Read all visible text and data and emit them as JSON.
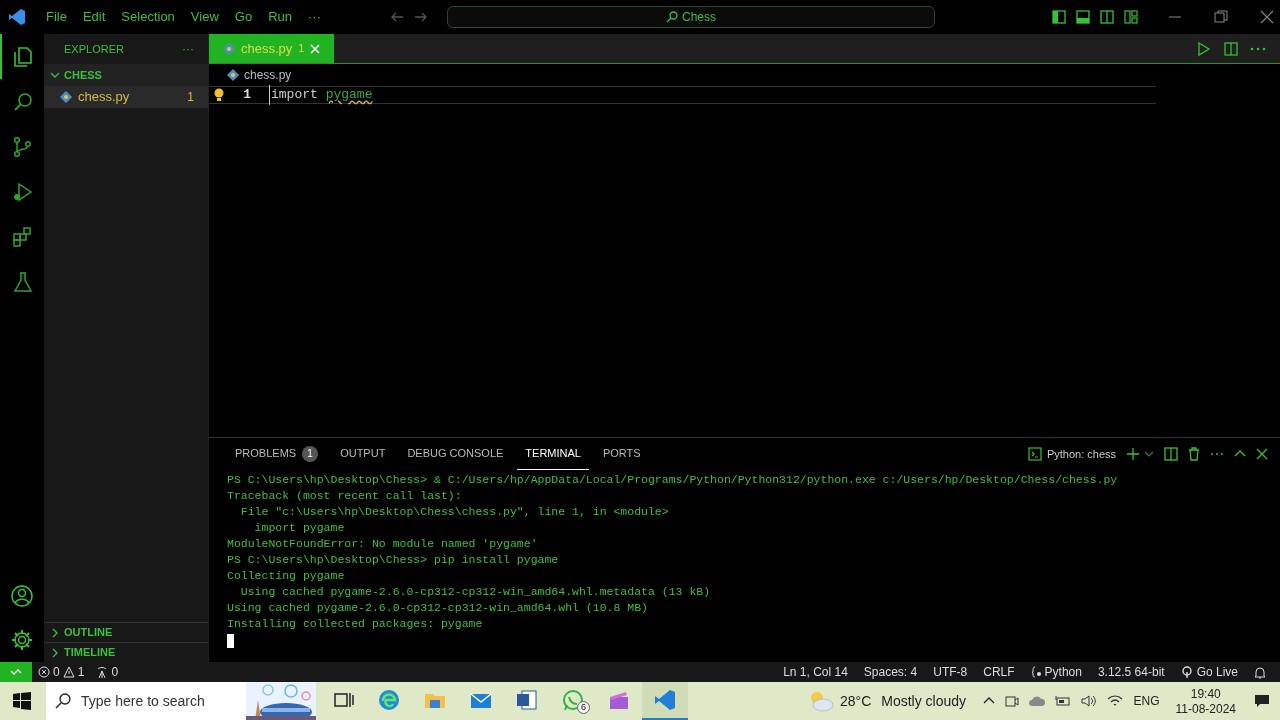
{
  "menu": [
    "File",
    "Edit",
    "Selection",
    "View",
    "Go",
    "Run",
    "···"
  ],
  "command_center": {
    "text": "Chess"
  },
  "activity_bar": [
    {
      "kind": "files",
      "selected": true
    },
    {
      "kind": "search",
      "selected": false
    },
    {
      "kind": "source",
      "selected": false
    },
    {
      "kind": "debug",
      "selected": false
    },
    {
      "kind": "extensions",
      "selected": false
    },
    {
      "kind": "testing",
      "selected": false
    }
  ],
  "sidebar": {
    "title": "EXPLORER",
    "more": "···",
    "folder": {
      "label": "CHESS",
      "expanded": true,
      "files": [
        {
          "name": "chess.py",
          "problems": "1",
          "selected": true
        }
      ]
    },
    "sections": [
      {
        "label": "OUTLINE",
        "expanded": false
      },
      {
        "label": "TIMELINE",
        "expanded": false
      }
    ]
  },
  "editor": {
    "tabs": [
      {
        "label": "chess.py",
        "problems": "1",
        "selected": true
      }
    ],
    "breadcrumb": "chess.py",
    "lines": [
      {
        "number": "1",
        "tokens": [
          {
            "text": "import",
            "kind": "keyword"
          },
          {
            "text": "pygame",
            "kind": "warning"
          }
        ]
      }
    ]
  },
  "panel": {
    "tabs": [
      {
        "label": "PROBLEMS",
        "badge": "1",
        "selected": false
      },
      {
        "label": "OUTPUT",
        "selected": false
      },
      {
        "label": "DEBUG CONSOLE",
        "selected": false
      },
      {
        "label": "TERMINAL",
        "selected": true
      },
      {
        "label": "PORTS",
        "selected": false
      }
    ],
    "terminal_profile": "Python: chess",
    "terminal_lines": [
      "PS C:\\Users\\hp\\Desktop\\Chess> & C:/Users/hp/AppData/Local/Programs/Python/Python312/python.exe c:/Users/hp/Desktop/Chess/chess.py",
      "Traceback (most recent call last):",
      "  File \"c:\\Users\\hp\\Desktop\\Chess\\chess.py\", line 1, in <module>",
      "    import pygame",
      "ModuleNotFoundError: No module named 'pygame'",
      "PS C:\\Users\\hp\\Desktop\\Chess> pip install pygame",
      "Collecting pygame",
      "  Using cached pygame-2.6.0-cp312-cp312-win_amd64.whl.metadata (13 kB)",
      "Using cached pygame-2.6.0-cp312-cp312-win_amd64.whl (10.8 MB)",
      "Installing collected packages: pygame"
    ]
  },
  "status_bar": {
    "errors": "0",
    "warnings": "1",
    "ports": "0",
    "right": [
      {
        "kind": "text",
        "text": "Ln 1, Col 14"
      },
      {
        "kind": "text",
        "text": "Spaces: 4"
      },
      {
        "kind": "text",
        "text": "UTF-8"
      },
      {
        "kind": "text",
        "text": "CRLF"
      },
      {
        "kind": "language",
        "text": "Python"
      },
      {
        "kind": "text",
        "text": "3.12.5 64-bit"
      },
      {
        "kind": "live",
        "text": "Go Live"
      },
      {
        "kind": "bell"
      }
    ]
  },
  "taskbar": {
    "search": {
      "placeholder": "Type here to search"
    },
    "apps": [
      {
        "kind": "taskview"
      },
      {
        "kind": "edge"
      },
      {
        "kind": "folder"
      },
      {
        "kind": "mail"
      },
      {
        "kind": "word"
      },
      {
        "kind": "chat",
        "badge": "6"
      },
      {
        "kind": "clapper"
      },
      {
        "kind": "code",
        "selected": true
      }
    ],
    "weather": {
      "temperature": "28°C",
      "condition": "Mostly cloudy"
    },
    "language": "ENG",
    "time": "19:40",
    "date": "11-08-2024"
  }
}
